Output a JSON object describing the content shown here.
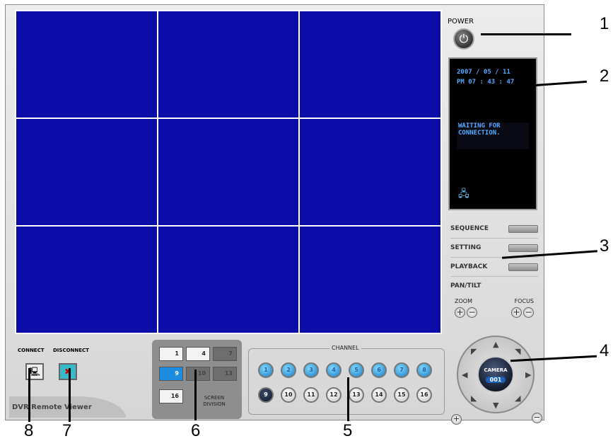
{
  "power": {
    "label": "POWER",
    "icon": "power-icon"
  },
  "status": {
    "date": "2007 / 05 / 11",
    "time": "PM 07 : 43 : 47",
    "message": "WAITING FOR CONNECTION."
  },
  "menu": {
    "sequence": "SEQUENCE",
    "setting": "SETTING",
    "playback": "PLAYBACK",
    "pantilt": "PAN/TILT",
    "zoom": "ZOOM",
    "focus": "FOCUS"
  },
  "camera": {
    "label": "CAMERA",
    "number": "001"
  },
  "connect": {
    "connect_label": "CONNECT",
    "disconnect_label": "DISCONNECT"
  },
  "app_name": "DVR Remote Viewer",
  "division": {
    "label": "SCREEN DIVISION",
    "buttons": [
      "1",
      "4",
      "7",
      "9",
      "10",
      "13",
      "16"
    ],
    "active": "9"
  },
  "channel": {
    "title": "CHANNEL",
    "buttons": [
      "1",
      "2",
      "3",
      "4",
      "5",
      "6",
      "7",
      "8",
      "9",
      "10",
      "11",
      "12",
      "13",
      "14",
      "15",
      "16"
    ],
    "selected": "9"
  },
  "callouts": [
    "1",
    "2",
    "3",
    "4",
    "5",
    "6",
    "7",
    "8"
  ],
  "colors": {
    "video_bg": "#0c0ca8",
    "accent": "#1d8be0"
  }
}
